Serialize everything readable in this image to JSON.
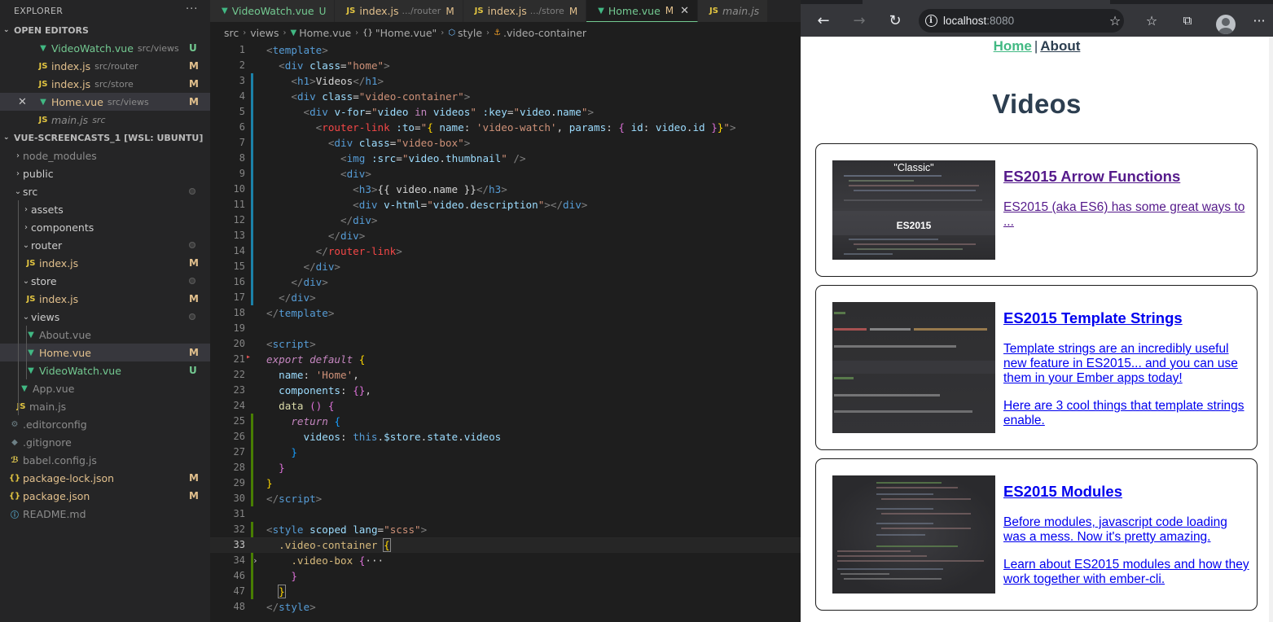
{
  "sidebar": {
    "title": "EXPLORER",
    "open_editors_label": "OPEN EDITORS",
    "open_editors": [
      {
        "name": "VideoWatch.vue",
        "desc": "src/views",
        "status": "U"
      },
      {
        "name": "index.js",
        "desc": "src/router",
        "status": "M"
      },
      {
        "name": "index.js",
        "desc": "src/store",
        "status": "M"
      },
      {
        "name": "Home.vue",
        "desc": "src/views",
        "status": "M"
      },
      {
        "name": "main.js",
        "desc": "src",
        "status": ""
      }
    ],
    "workspace_label": "VUE-SCREENCASTS_1 [WSL: UBUNTU]",
    "tree": [
      {
        "name": "node_modules"
      },
      {
        "name": "public"
      },
      {
        "name": "src"
      },
      {
        "name": "assets"
      },
      {
        "name": "components"
      },
      {
        "name": "router"
      },
      {
        "name": "index.js",
        "status": "M"
      },
      {
        "name": "store"
      },
      {
        "name": "index.js",
        "status": "M"
      },
      {
        "name": "views"
      },
      {
        "name": "About.vue"
      },
      {
        "name": "Home.vue",
        "status": "M"
      },
      {
        "name": "VideoWatch.vue",
        "status": "U"
      },
      {
        "name": "App.vue"
      },
      {
        "name": "main.js"
      },
      {
        "name": ".editorconfig"
      },
      {
        "name": ".gitignore"
      },
      {
        "name": "babel.config.js"
      },
      {
        "name": "package-lock.json",
        "status": "M"
      },
      {
        "name": "package.json",
        "status": "M"
      },
      {
        "name": "README.md"
      }
    ]
  },
  "tabs": [
    {
      "name": "VideoWatch.vue",
      "desc": "",
      "status": "U"
    },
    {
      "name": "index.js",
      "desc": ".../router",
      "status": "M"
    },
    {
      "name": "index.js",
      "desc": ".../store",
      "status": "M"
    },
    {
      "name": "Home.vue",
      "desc": "",
      "status": "M"
    },
    {
      "name": "main.js",
      "desc": "",
      "status": ""
    }
  ],
  "breadcrumb": [
    "src",
    "views",
    "Home.vue",
    "\"Home.vue\"",
    "style",
    ".video-container"
  ],
  "code": {
    "line_numbers": [
      "1",
      "2",
      "3",
      "4",
      "5",
      "6",
      "7",
      "8",
      "9",
      "10",
      "11",
      "12",
      "13",
      "14",
      "15",
      "16",
      "17",
      "18",
      "19",
      "20",
      "21",
      "22",
      "23",
      "24",
      "25",
      "26",
      "27",
      "28",
      "29",
      "30",
      "31",
      "32",
      "33",
      "34",
      "46",
      "47",
      "48"
    ]
  },
  "browser": {
    "url_host": "localhost",
    "url_port": ":8080",
    "nav_home": "Home",
    "nav_sep": "|",
    "nav_about": "About",
    "heading": "Videos",
    "videos": [
      {
        "title": "ES2015 Arrow Functions",
        "desc": [
          "ES2015 (aka ES6) has some great ways to ..."
        ],
        "thumb_caption_top": "\"Classic\"",
        "thumb_caption_mid": "ES2015"
      },
      {
        "title": "ES2015 Template Strings",
        "desc": [
          "Template strings are an incredibly useful new feature in ES2015... and you can use them in your Ember apps today!",
          "Here are 3 cool things that template strings enable."
        ]
      },
      {
        "title": "ES2015 Modules",
        "desc": [
          "Before modules, javascript code loading was a mess. Now it's pretty amazing.",
          "Learn about ES2015 modules and how they work together with ember-cli."
        ]
      }
    ]
  }
}
